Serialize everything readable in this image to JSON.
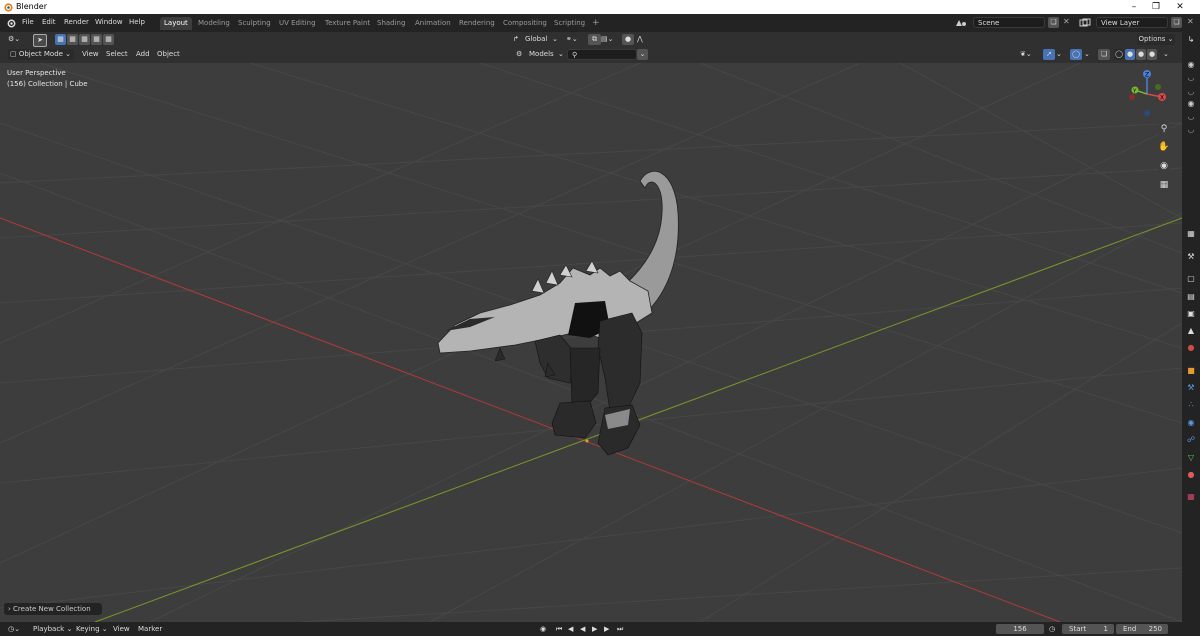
{
  "window": {
    "title": "Blender"
  },
  "menu": [
    "File",
    "Edit",
    "Render",
    "Window",
    "Help"
  ],
  "workspaces": [
    "Layout",
    "Modeling",
    "Sculpting",
    "UV Editing",
    "Texture Paint",
    "Shading",
    "Animation",
    "Rendering",
    "Compositing",
    "Scripting"
  ],
  "active_workspace": "Layout",
  "scene": {
    "label": "Scene"
  },
  "view_layer": {
    "label": "View Layer"
  },
  "toolheader": {
    "orientation": "Global",
    "options_label": "Options"
  },
  "viewheader": {
    "mode": "Object Mode",
    "view": "View",
    "select": "Select",
    "add": "Add",
    "object": "Object",
    "models": "Models"
  },
  "viewport": {
    "perspective": "User Perspective",
    "collection_info": "(156) Collection | Cube"
  },
  "gizmo": {
    "x": "X",
    "y": "Y",
    "z": "Z"
  },
  "collection_popup": "Create New Collection",
  "timeline": {
    "playback": "Playback",
    "keying": "Keying",
    "view": "View",
    "marker": "Marker",
    "current_frame": "156",
    "start_label": "Start",
    "start": "1",
    "end_label": "End",
    "end": "250"
  },
  "colors": {
    "x_axis": "#b13a3a",
    "y_axis": "#7a9a2a",
    "accent": "#4772b3"
  }
}
